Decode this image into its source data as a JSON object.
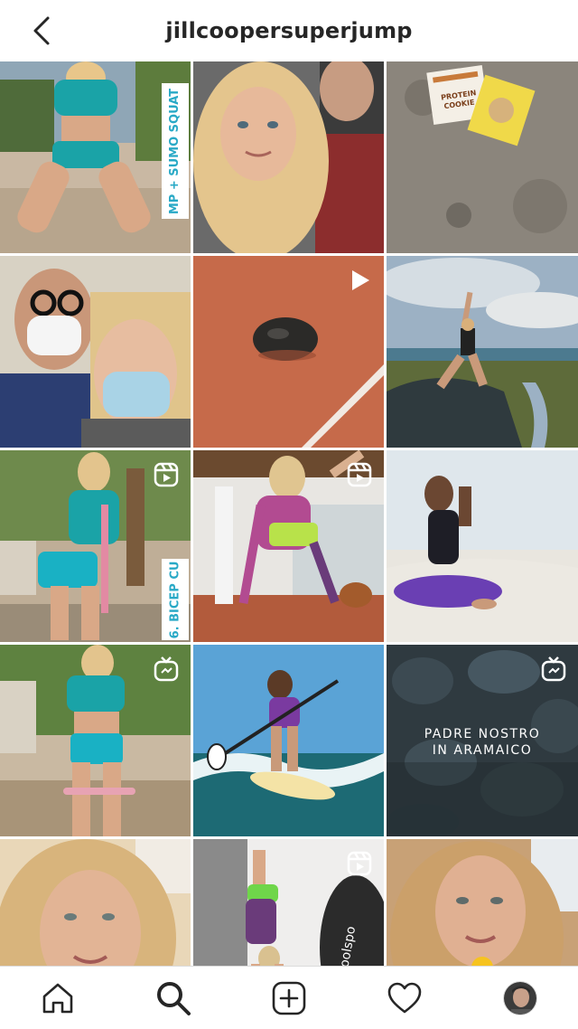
{
  "header": {
    "username": "jillcoopersuperjump",
    "back_icon": "chevron-left-icon"
  },
  "grid": {
    "posts": [
      {
        "badge": "none",
        "overlay": "MP + SUMO SQUAT"
      },
      {
        "badge": "none"
      },
      {
        "badge": "none"
      },
      {
        "badge": "none"
      },
      {
        "badge": "video-play-icon"
      },
      {
        "badge": "none"
      },
      {
        "badge": "reel-icon",
        "overlay": "6. BICEP CU"
      },
      {
        "badge": "reel-icon"
      },
      {
        "badge": "none"
      },
      {
        "badge": "igtv-icon"
      },
      {
        "badge": "none"
      },
      {
        "badge": "igtv-icon",
        "caption_line1": "PADRE NOSTRO",
        "caption_line2": "IN ARAMAICO"
      },
      {
        "badge": "none"
      },
      {
        "badge": "reel-icon"
      },
      {
        "badge": "none"
      }
    ]
  },
  "tabbar": {
    "items": [
      "home-icon",
      "search-icon",
      "create-post-icon",
      "activity-heart-icon",
      "profile-avatar"
    ]
  }
}
